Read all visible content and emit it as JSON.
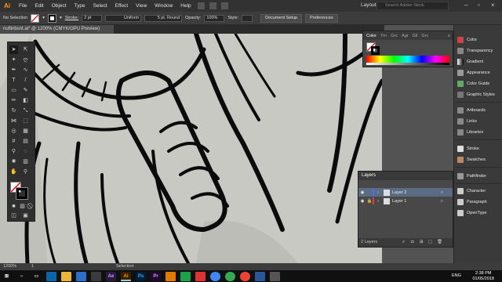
{
  "app": {
    "logo": "Ai",
    "layout": "Layout",
    "search_placeholder": "Search Adobe Stock"
  },
  "menu": [
    "File",
    "Edit",
    "Object",
    "Type",
    "Select",
    "Effect",
    "View",
    "Window",
    "Help"
  ],
  "control_bar": {
    "selection": "No Selection",
    "stroke_label": "Stroke:",
    "stroke_weight": "2 pt",
    "profile": "Uniform",
    "brush": "5 pt. Round",
    "opacity_label": "Opacity:",
    "opacity": "100%",
    "style_label": "Style:",
    "doc_setup": "Document Setup",
    "preferences": "Preferences"
  },
  "document_tab": "nuflinbsnt.ai* @ 1200% (CMYK/GPU Preview)",
  "color_panel": {
    "tabs": [
      "Color",
      "Trn",
      "Grc",
      "Agr",
      "Gll",
      "Grc"
    ]
  },
  "right_panels": [
    {
      "label": "Color",
      "icon": "color-icon"
    },
    {
      "label": "Transparency",
      "icon": "transparency-icon"
    },
    {
      "label": "Gradient",
      "icon": "gradient-icon"
    },
    {
      "label": "Appearance",
      "icon": "appearance-icon"
    },
    {
      "label": "Color Guide",
      "icon": "color-guide-icon"
    },
    {
      "label": "Graphic Styles",
      "icon": "graphic-styles-icon"
    },
    {
      "label": "Artboards",
      "icon": "artboards-icon"
    },
    {
      "label": "Links",
      "icon": "links-icon"
    },
    {
      "label": "Libraries",
      "icon": "libraries-icon"
    },
    {
      "label": "Stroke",
      "icon": "stroke-icon"
    },
    {
      "label": "Swatches",
      "icon": "swatches-icon"
    },
    {
      "label": "Pathfinder",
      "icon": "pathfinder-icon"
    },
    {
      "label": "Character",
      "icon": "character-icon"
    },
    {
      "label": "Paragraph",
      "icon": "paragraph-icon"
    },
    {
      "label": "OpenType",
      "icon": "opentype-icon"
    }
  ],
  "layers": {
    "title": "Layers",
    "items": [
      {
        "name": "Layer 2",
        "color": "#4f6dff",
        "selected": true
      },
      {
        "name": "Layer 1",
        "color": "#d34646",
        "selected": false
      }
    ],
    "count": "2 Layers"
  },
  "status": {
    "zoom": "1200%",
    "page": "1",
    "tool": "Selection"
  },
  "taskbar": {
    "time": "2:38 PM",
    "date": "01/05/2018",
    "lang": "ENG"
  },
  "colors": {
    "accent": "#ff9a00",
    "panel_dark": "#3a3a3a",
    "selected_layer": "#5a6b84"
  }
}
